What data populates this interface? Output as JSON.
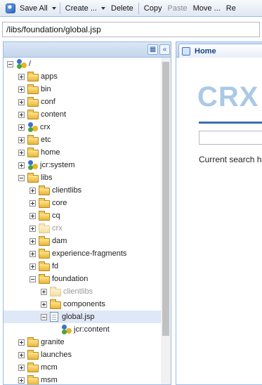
{
  "toolbar": {
    "save_all": "Save All",
    "create": "Create ...",
    "delete": "Delete",
    "copy": "Copy",
    "paste": "Paste",
    "move": "Move ...",
    "rename": "Re"
  },
  "address": {
    "value": "/libs/foundation/global.jsp"
  },
  "tree": [
    {
      "label": "/",
      "icon": "node",
      "exp": "minus",
      "level": 0
    },
    {
      "label": "apps",
      "icon": "folder",
      "exp": "plus",
      "level": 1
    },
    {
      "label": "bin",
      "icon": "folder",
      "exp": "plus",
      "level": 1
    },
    {
      "label": "conf",
      "icon": "folder",
      "exp": "plus",
      "level": 1
    },
    {
      "label": "content",
      "icon": "folder",
      "exp": "plus",
      "level": 1
    },
    {
      "label": "crx",
      "icon": "node",
      "exp": "plus",
      "level": 1
    },
    {
      "label": "etc",
      "icon": "folder",
      "exp": "plus",
      "level": 1
    },
    {
      "label": "home",
      "icon": "folder",
      "exp": "plus",
      "level": 1
    },
    {
      "label": "jcr:system",
      "icon": "node",
      "exp": "plus",
      "level": 1
    },
    {
      "label": "libs",
      "icon": "folder",
      "exp": "minus",
      "level": 1
    },
    {
      "label": "clientlibs",
      "icon": "folder",
      "exp": "plus",
      "level": 2
    },
    {
      "label": "core",
      "icon": "folder",
      "exp": "plus",
      "level": 2
    },
    {
      "label": "cq",
      "icon": "folder",
      "exp": "plus",
      "level": 2
    },
    {
      "label": "crx",
      "icon": "folder",
      "exp": "plus",
      "level": 2,
      "faded": true
    },
    {
      "label": "dam",
      "icon": "folder",
      "exp": "plus",
      "level": 2
    },
    {
      "label": "experience-fragments",
      "icon": "folder",
      "exp": "plus",
      "level": 2
    },
    {
      "label": "fd",
      "icon": "folder",
      "exp": "plus",
      "level": 2
    },
    {
      "label": "foundation",
      "icon": "folder",
      "exp": "minus",
      "level": 2
    },
    {
      "label": "clientlibs",
      "icon": "folder",
      "exp": "plus",
      "level": 3,
      "faded": true
    },
    {
      "label": "components",
      "icon": "folder",
      "exp": "plus",
      "level": 3
    },
    {
      "label": "global.jsp",
      "icon": "file",
      "exp": "minus",
      "level": 3,
      "selected": true
    },
    {
      "label": "jcr:content",
      "icon": "node",
      "exp": "none",
      "level": 4
    },
    {
      "label": "granite",
      "icon": "folder",
      "exp": "plus",
      "level": 1
    },
    {
      "label": "launches",
      "icon": "folder",
      "exp": "plus",
      "level": 1
    },
    {
      "label": "mcm",
      "icon": "folder",
      "exp": "plus",
      "level": 1
    },
    {
      "label": "msm",
      "icon": "folder",
      "exp": "plus",
      "level": 1
    }
  ],
  "right": {
    "tab_label": "Home",
    "logo_text": "CRX",
    "search_status": "Current search ha"
  }
}
